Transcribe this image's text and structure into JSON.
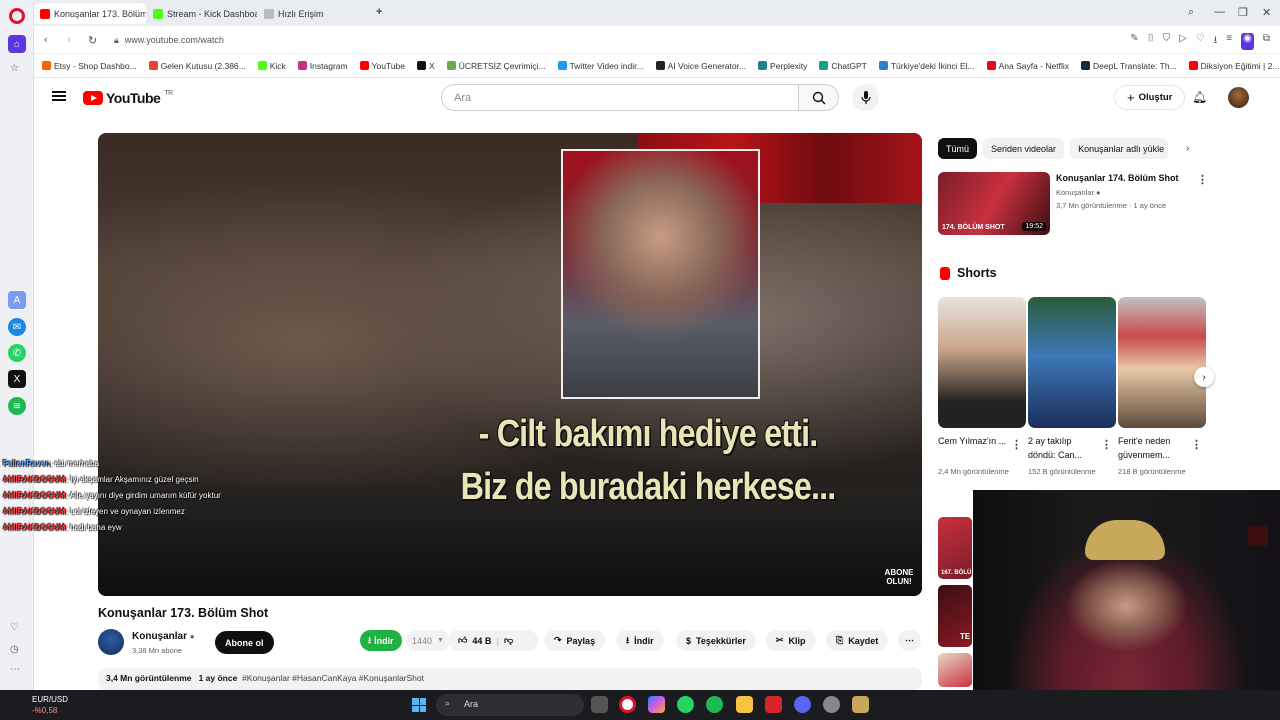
{
  "browser": {
    "tabs": [
      {
        "label": "Konuşanlar 173. Bölüm",
        "color": "#ff0000"
      },
      {
        "label": "Stream - Kick Dashboard",
        "color": "#53fc18"
      },
      {
        "label": "Hızlı Erişim",
        "color": "#888888"
      }
    ],
    "new_tab": "+",
    "url": "www.youtube.com/watch",
    "bookmarks": [
      {
        "label": "Etsy - Shop Dashbo...",
        "color": "#f56400"
      },
      {
        "label": "Gelen Kutusu (2.386...",
        "color": "#ea4335"
      },
      {
        "label": "Kick",
        "color": "#53fc18"
      },
      {
        "label": "Instagram",
        "color": "#c13584"
      },
      {
        "label": "YouTube",
        "color": "#ff0000"
      },
      {
        "label": "X",
        "color": "#111111"
      },
      {
        "label": "ÜCRETSİZ Çevrimiçi...",
        "color": "#6aa84f"
      },
      {
        "label": "Twitter Video indir...",
        "color": "#1d9bf0"
      },
      {
        "label": "AI Voice Generator...",
        "color": "#222222"
      },
      {
        "label": "Perplexity",
        "color": "#20808d"
      },
      {
        "label": "ChatGPT",
        "color": "#10a37f"
      },
      {
        "label": "Türkiye'deki İkinci El...",
        "color": "#2f7dd1"
      },
      {
        "label": "Ana Sayfa - Netflix",
        "color": "#e50914"
      },
      {
        "label": "DeepL Translate: Th...",
        "color": "#0f2b46"
      },
      {
        "label": "Diksiyon Eğitimi | 2...",
        "color": "#ff0000"
      }
    ]
  },
  "youtube": {
    "logo": "YouTube",
    "region": "TR",
    "search_placeholder": "Ara",
    "create_label": "Oluştur"
  },
  "video": {
    "subtitle_line1": "- Cilt bakımı hediye etti.",
    "subtitle_line2": "Biz de buradaki herkese...",
    "watermark": "ABONE OLUN!",
    "title": "Konuşanlar 173. Bölüm Shot",
    "channel": "Konuşanlar",
    "subscribers": "3,38 Mn abone",
    "subscribe_label": "Abone ol",
    "download_ext_label": "İndir",
    "download_ext_quality": "1440",
    "likes": "44 B",
    "share_label": "Paylaş",
    "download_label": "İndir",
    "thanks_label": "Teşekkürler",
    "clip_label": "Klip",
    "save_label": "Kaydet",
    "views": "3,4 Mn görüntülenme",
    "age": "1 ay önce",
    "hashtags": "#Konuşanlar #HasanCanKaya #KonuşanlarShot"
  },
  "chat": [
    {
      "user": "FallenRaven",
      "text": ": abi merhaba",
      "color": "#5aa8ff"
    },
    {
      "user": "AMIRAKDOGUM",
      "text": ": İyi akşamlar Akşamınız güzel geçsin",
      "color": "#ff3b3b"
    },
    {
      "user": "AMIRAKDOGUM",
      "text": ": Aile yayını diye girdim umarım küfür yoktur",
      "color": "#ff3b3b"
    },
    {
      "user": "AMIRAKDOGUM",
      "text": ": Lol izleyen ve oynayan izlenmez",
      "color": "#ff3b3b"
    },
    {
      "user": "AMIRAKDOGUM",
      "text": ": hadi bana eyw",
      "color": "#ff3b3b"
    }
  ],
  "sidebar": {
    "chips": [
      "Tümü",
      "Seriden videolar",
      "Konuşanlar adlı yükle"
    ],
    "related": {
      "title": "Konuşanlar 174. Bölüm Shot",
      "channel": "Konuşanlar",
      "meta": "3,7 Mn görüntülenme · 1 ay önce",
      "thumb_text": "174. BÖLÜM SHOT",
      "duration": "19:52"
    },
    "shorts_header": "Shorts",
    "shorts": [
      {
        "title": "Cem Yılmaz'ın ...",
        "views": "2,4 Mn görüntülenme",
        "color": "#d9b89a"
      },
      {
        "title": "2 ay takılıp döndü: Can...",
        "views": "152 B görüntülenme",
        "color": "#2f6fb5"
      },
      {
        "title": "Ferit'e neden güvenmem...",
        "views": "218 B görüntülenme",
        "color": "#c94a4a"
      }
    ],
    "thumb2_text": "167. BÖLÜ",
    "thumb3_text": "TE"
  },
  "taskbar": {
    "ticker": "EUR/USD",
    "change": "-%0,58",
    "search": "Ara"
  }
}
